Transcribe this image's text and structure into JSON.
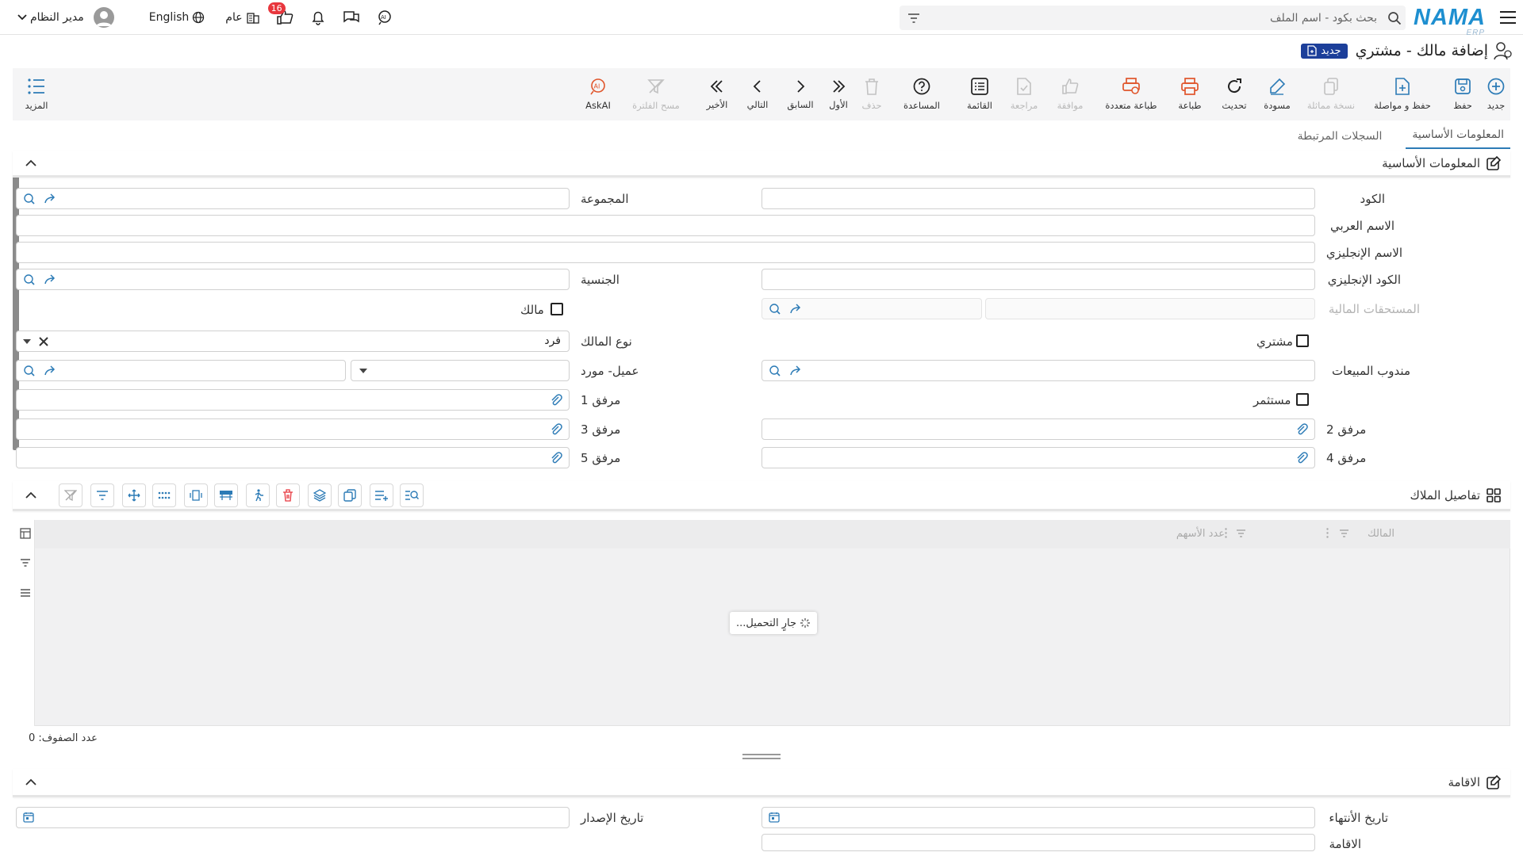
{
  "topbar": {
    "logo": "NAMA",
    "logo_sub": "ERP",
    "search_placeholder": "بحث بكود - اسم الملف",
    "user_name": "مدير النظام",
    "language": "English",
    "public_label": "عام",
    "notification_count": "16"
  },
  "page": {
    "title": "إضافة مالك - مشتري",
    "status_badge": "جديد"
  },
  "toolbar": {
    "new": "جديد",
    "save": "حفظ",
    "save_continue": "حفظ و مواصلة",
    "copy": "نسخة مماثلة",
    "draft": "مسودة",
    "refresh": "تحديث",
    "print": "طباعة",
    "multi_print": "طباعة متعددة",
    "approve": "موافقة",
    "review": "مراجعة",
    "list": "القائمة",
    "help": "المساعدة",
    "delete": "حذف",
    "first": "الأول",
    "previous": "السابق",
    "next": "التالي",
    "last": "الأخير",
    "clear_filter": "مسح الفلترة",
    "askai": "AskAI",
    "more": "المزيد"
  },
  "tabs": [
    "المعلومات الأساسية",
    "السجلات المرتبطة"
  ],
  "basic_section": {
    "title": "المعلومات الأساسية",
    "code": "الكود",
    "group": "المجموعة",
    "arabic_name": "الاسم العربي",
    "english_name": "الاسم الإنجليزي",
    "english_code": "الكود الإنجليزي",
    "nationality": "الجنسية",
    "financial_dues": "المستحقات المالية",
    "owner": "مالك",
    "buyer": "مشتري",
    "owner_type": "نوع المالك",
    "owner_type_value": "فرد",
    "sales_rep": "مندوب المبيعات",
    "customer_supplier": "عميل- مورد",
    "investor": "مستثمر",
    "attachment1": "مرفق 1",
    "attachment2": "مرفق 2",
    "attachment3": "مرفق 3",
    "attachment4": "مرفق 4",
    "attachment5": "مرفق 5"
  },
  "owners_section": {
    "title": "تفاصيل الملاك",
    "columns": [
      "المالك",
      "عدد الأسهم"
    ],
    "loading": "جارٍ التحميل...",
    "row_count_label": "عدد الصفوف: 0"
  },
  "residence_section": {
    "title": "الاقامة",
    "end_date": "تاريخ الأنتهاء",
    "issue_date": "تاريخ الإصدار",
    "residence": "الاقامة"
  },
  "colors": {
    "accent": "#2c7bb6",
    "brand": "#1e8fd0",
    "badge_bg": "#1c3f9a",
    "notif": "#e8363d",
    "print_orange": "#e0552b"
  }
}
